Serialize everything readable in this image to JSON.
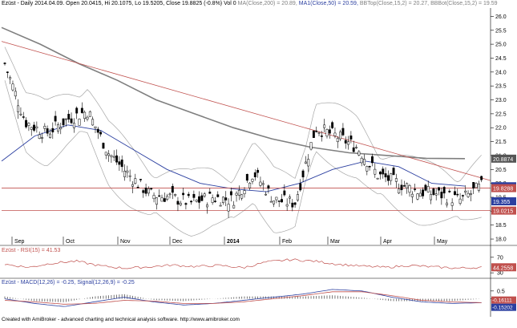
{
  "panels": {
    "price": {
      "header": {
        "ticker": "Ezüst - Daily 2014.04.09. Open 20.0415, Hi 20.1075, Lo 19.5205, Close 19.8825 (-0.8%) Vol 0",
        "ma200": "MA(Close,200) = 20.89,",
        "ma50": "MA1(Close,50) = 20.59,",
        "bbtop": "BBTop(Close,15,2) = 20.27,",
        "bbbot": "BBBot(Close,15,2) = 19.59"
      },
      "y_ticks": [
        "26.0",
        "25.5",
        "25.0",
        "24.5",
        "24.0",
        "23.5",
        "23.0",
        "22.5",
        "22.0",
        "21.5",
        "21.0",
        "20.5",
        "20.0",
        "19.5",
        "19.0",
        "18.5",
        "18.0"
      ],
      "x_ticks": [
        "Sep",
        "Oct",
        "Nov",
        "Dec",
        "2014",
        "Feb",
        "Mar",
        "Apr",
        "May"
      ],
      "price_labels": [
        {
          "text": "20.8874",
          "color": "#555555"
        },
        {
          "text": "19.896",
          "color": "#2b3fa0"
        },
        {
          "text": "19.8288",
          "color": "#c0504d"
        },
        {
          "text": "19.355",
          "color": "#2b3fa0"
        },
        {
          "text": "19.0215",
          "color": "#c0504d"
        }
      ]
    },
    "rsi": {
      "header": {
        "name": "Ezüst - RSI(15) = 41.53"
      },
      "y_ticks": [
        "70",
        "30"
      ],
      "value_label": "44.2558"
    },
    "macd": {
      "header": {
        "name": "Ezüst - MACD(12,26) = -0.25, Signal(12,26,9) = -0.25"
      },
      "y_ticks": [
        "0.5",
        "0"
      ],
      "value_label_1": "-0.16111",
      "value_label_2": "-0.15202"
    }
  },
  "footer": "Created with AmiBroker - advanced charting and technical analysis software. http://www.amibroker.com",
  "colors": {
    "price_line": "#000000",
    "ma200": "#7f7f7f",
    "ma50": "#2b3fa0",
    "bb": "#a6a6a6",
    "trend": "#c0504d",
    "rsi": "#c0504d",
    "macd": "#2b3fa0",
    "signal": "#c0504d",
    "hist": "#555555"
  },
  "chart_data": [
    {
      "type": "line",
      "title": "Ezüst - Daily 2014.04.09.",
      "ylim": [
        17.8,
        26.3
      ],
      "x": [
        "Sep",
        "Oct",
        "Nov",
        "Dec",
        "2014",
        "Feb",
        "Mar",
        "Apr",
        "May"
      ],
      "series": [
        {
          "name": "Close",
          "values": [
            24.3,
            22.2,
            21.8,
            22.3,
            22.6,
            21.1,
            20.3,
            19.6,
            19.5,
            19.3,
            19.5,
            19.4,
            20.4,
            19.4,
            19.3,
            22.0,
            21.7,
            21.3,
            20.3,
            20.0,
            19.7,
            19.6,
            19.4,
            19.9
          ]
        },
        {
          "name": "MA(Close,200)",
          "values": [
            25.6,
            25.0,
            24.3,
            23.7,
            23.0,
            22.5,
            22.0,
            21.6,
            21.3,
            21.1,
            21.0,
            20.9,
            20.89
          ]
        },
        {
          "name": "MA1(Close,50)",
          "values": [
            20.8,
            21.7,
            22.1,
            21.9,
            21.2,
            20.5,
            20.0,
            19.8,
            19.7,
            20.0,
            20.5,
            20.8,
            20.6,
            20.0,
            19.9
          ]
        }
      ]
    },
    {
      "type": "line",
      "title": "Ezüst - RSI(15) = 41.53",
      "ylim": [
        0,
        100
      ],
      "series": [
        {
          "name": "RSI(15)",
          "values": [
            52,
            44,
            55,
            60,
            48,
            42,
            45,
            50,
            46,
            49,
            43,
            58,
            64,
            60,
            52,
            47,
            44,
            49,
            45,
            42,
            44
          ]
        }
      ]
    },
    {
      "type": "line",
      "title": "Ezüst - MACD(12,26) = -0.25, Signal(12,26,9) = -0.25",
      "ylim": [
        -1.0,
        0.8
      ],
      "series": [
        {
          "name": "MACD(12,26)",
          "values": [
            0.0,
            -0.3,
            -0.5,
            -0.2,
            0.1,
            -0.2,
            -0.4,
            -0.3,
            -0.1,
            0.1,
            0.3,
            0.6,
            0.5,
            0.1,
            -0.2,
            -0.3,
            -0.25
          ]
        },
        {
          "name": "Signal(12,26,9)",
          "values": [
            -0.1,
            -0.2,
            -0.35,
            -0.3,
            -0.1,
            -0.15,
            -0.3,
            -0.3,
            -0.2,
            0.0,
            0.2,
            0.45,
            0.45,
            0.2,
            -0.1,
            -0.2,
            -0.25
          ]
        }
      ]
    }
  ]
}
